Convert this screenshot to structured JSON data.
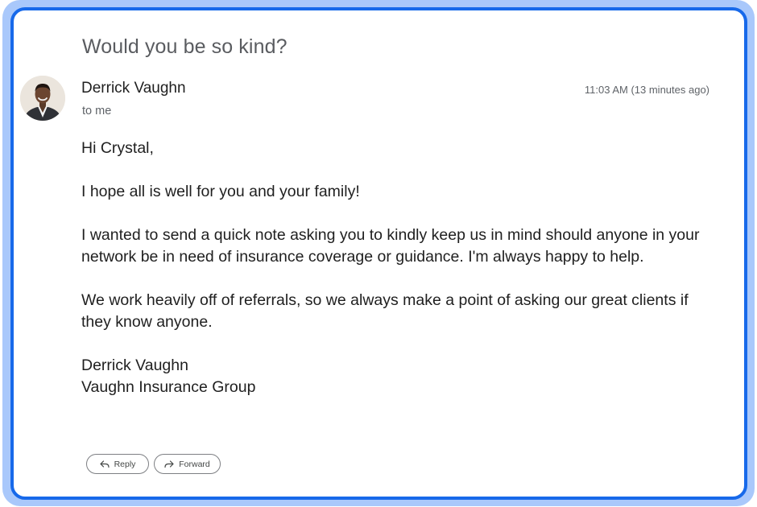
{
  "email": {
    "subject": "Would you be so kind?",
    "sender_name": "Derrick Vaughn",
    "recipient": "to me",
    "timestamp": "11:03 AM (13 minutes ago)",
    "body": {
      "greeting": "Hi Crystal,",
      "paragraphs": [
        "I hope all is well for you and your family!",
        "I wanted to send a quick note asking you to kindly keep us in mind should anyone in your network be in need of insurance coverage or guidance. I'm always happy to help.",
        "We work heavily off of referrals, so we always make a point of asking our great clients if they know anyone."
      ],
      "signature_name": "Derrick Vaughn",
      "signature_company": "Vaughn Insurance Group"
    }
  },
  "actions": {
    "reply_label": "Reply",
    "reply_icon": "reply-arrow-icon",
    "forward_label": "Forward",
    "forward_icon": "forward-arrow-icon"
  },
  "colors": {
    "frame_outer": "#a9c8fb",
    "frame_border": "#1769ea",
    "text_primary": "#1f1f1f",
    "text_secondary": "#5f6368"
  }
}
